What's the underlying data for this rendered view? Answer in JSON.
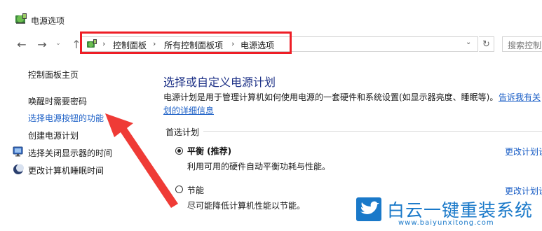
{
  "window": {
    "title": "电源选项",
    "icon": "power-options-icon"
  },
  "toolbar": {
    "back_icon": "←",
    "forward_icon": "→",
    "recent_icon": "⌄",
    "up_icon": "↑",
    "refresh_icon": "↻",
    "dropdown_icon": "⌄",
    "breadcrumb_sep": "›",
    "breadcrumbs": [
      "控制面板",
      "所有控制面板项",
      "电源选项"
    ],
    "search_placeholder": "搜索控制"
  },
  "sidebar": {
    "home": "控制面板主页",
    "items": [
      {
        "label": "唤醒时需要密码",
        "icon": null
      },
      {
        "label": "选择电源按钮的功能",
        "icon": null
      },
      {
        "label": "创建电源计划",
        "icon": null
      },
      {
        "label": "选择关闭显示器的时间",
        "icon": "display-icon"
      },
      {
        "label": "更改计算机睡眠时间",
        "icon": "moon-icon"
      }
    ]
  },
  "main": {
    "heading": "选择或自定义电源计划",
    "description": "电源计划是用于管理计算机如何使用电源的一套硬件和系统设置(如显示器亮度、睡眠等)。",
    "description_link_part1": "告诉我有关",
    "description_link_part2": "划的详细信息",
    "preferred_label": "首选计划",
    "plans": [
      {
        "name": "平衡 (推荐)",
        "description": "利用可用的硬件自动平衡功耗与性能。",
        "link": "更改计划设",
        "selected": true
      },
      {
        "name": "节能",
        "description": "尽可能降低计算机性能以节能。",
        "link": "更改计划设",
        "selected": false
      }
    ]
  },
  "colors": {
    "highlight_box": "#ee1e26",
    "arrow": "#ef3b36",
    "link": "#1a5ec6",
    "heading": "#1e3287",
    "watermark": "#1a79c9"
  },
  "watermark": {
    "title": "白云一键重装系统",
    "url": "www.baiyunxitong.com"
  }
}
